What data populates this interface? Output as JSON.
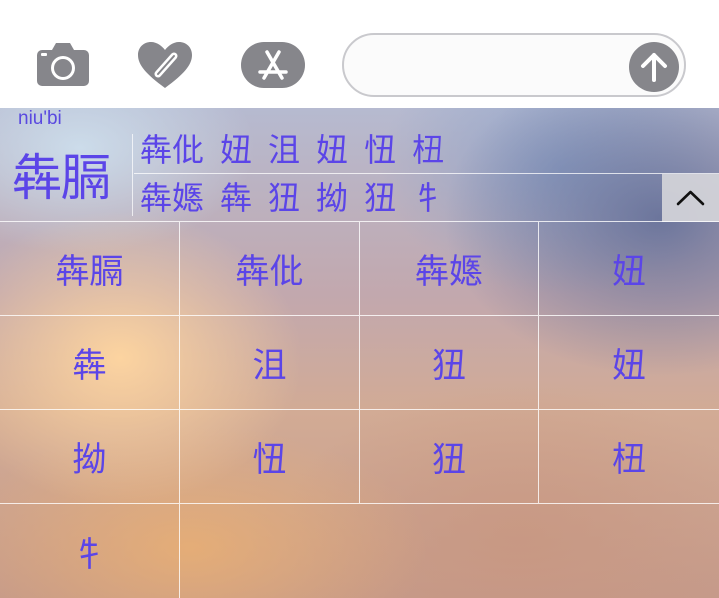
{
  "message_bar": {
    "icons": [
      "camera-icon",
      "digital-touch-heart-icon",
      "app-store-icon"
    ],
    "input_value": "",
    "send_icon": "arrow-up-icon"
  },
  "keyboard": {
    "pinyin": "niu'bi",
    "composed": "犇膈",
    "candidate_rows": [
      [
        "犇仳",
        "妞",
        "沮",
        "妞",
        "忸",
        "杻"
      ],
      [
        "犇嫕",
        "犇",
        "狃",
        "拗",
        "狃",
        "牜"
      ]
    ],
    "collapse_icon": "chevron-up-icon",
    "grid": [
      [
        "犇膈",
        "犇仳",
        "犇嫕",
        "妞"
      ],
      [
        "犇",
        "沮",
        "狃",
        "妞"
      ],
      [
        "拗",
        "忸",
        "狃",
        "杻"
      ],
      [
        "牜"
      ]
    ]
  },
  "colors": {
    "accent_text": "#5b45e8",
    "icon_gray": "#86868b"
  }
}
